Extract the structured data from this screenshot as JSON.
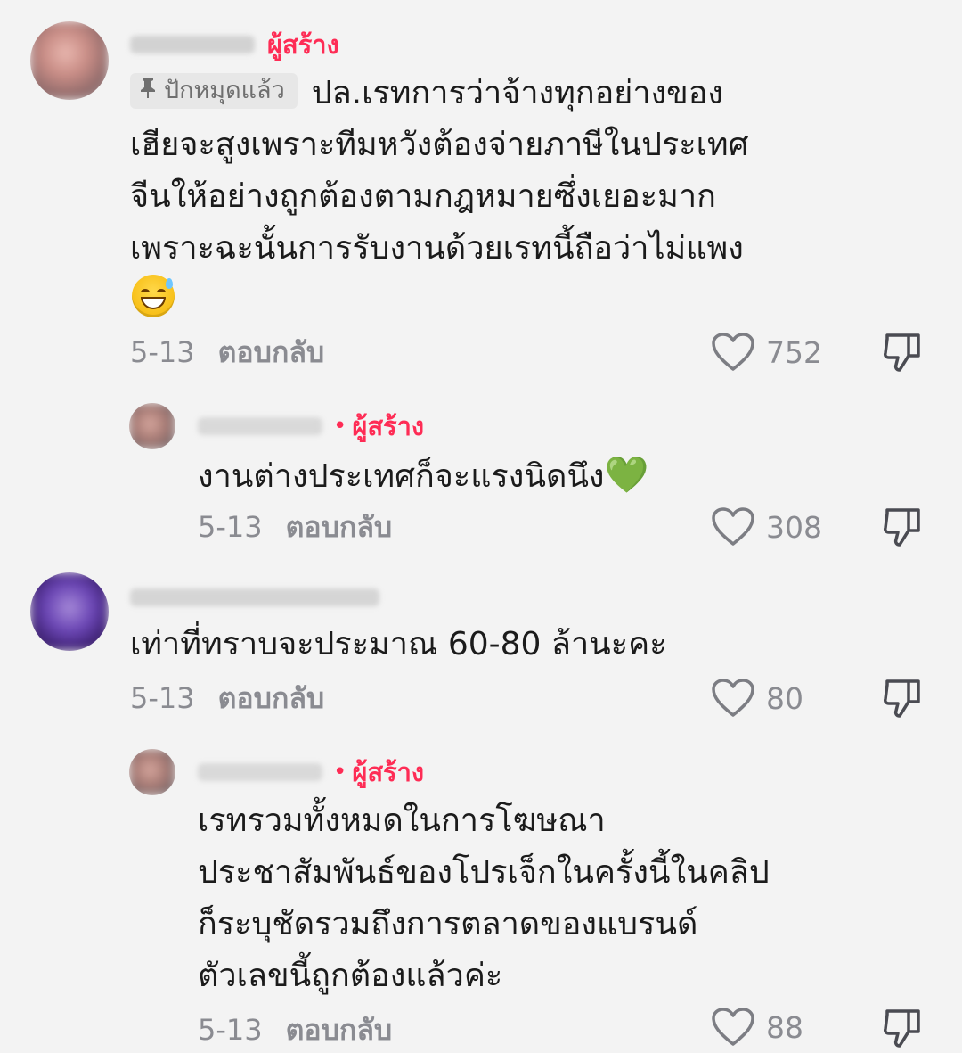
{
  "creator_label": "ผู้สร้าง",
  "reply_label": "ตอบกลับ",
  "colors": {
    "accent": "#fe2c55",
    "meta_gray": "#8a8b91",
    "background": "#f3f3f3",
    "badge_bg": "#e7e7e7"
  },
  "comments": [
    {
      "pinned_label": "ปักหมุดแล้ว",
      "text": "ปล.เรทการว่าจ้างทุกอย่างของ\nเฮียจะสูงเพราะทีมหวังต้องจ่ายภาษีในประเทศ\nจีนให้อย่างถูกต้องตามกฎหมายซึ่งเยอะมาก\nเพราะฉะนั้นการรับงานด้วยเรทนี้ถือว่าไม่แพง",
      "emoji": "smiling-face-with-sweat-icon",
      "date": "5-13",
      "likes": "752"
    },
    {
      "text": "งานต่างประเทศก็จะแรงนิดนึง",
      "emoji": "💚",
      "date": "5-13",
      "likes": "308"
    },
    {
      "text": "เท่าที่ทราบจะประมาณ 60-80 ล้านะคะ",
      "date": "5-13",
      "likes": "80"
    },
    {
      "text": "เรทรวมทั้งหมดในการโฆษณา\nประชาสัมพันธ์ของโปรเจ็กในครั้งนี้ในคลิป\nก็ระบุชัดรวมถึงการตลาดของแบรนด์\nตัวเลขนี้ถูกต้องแล้วค่ะ",
      "date": "5-13",
      "likes": "88"
    }
  ]
}
